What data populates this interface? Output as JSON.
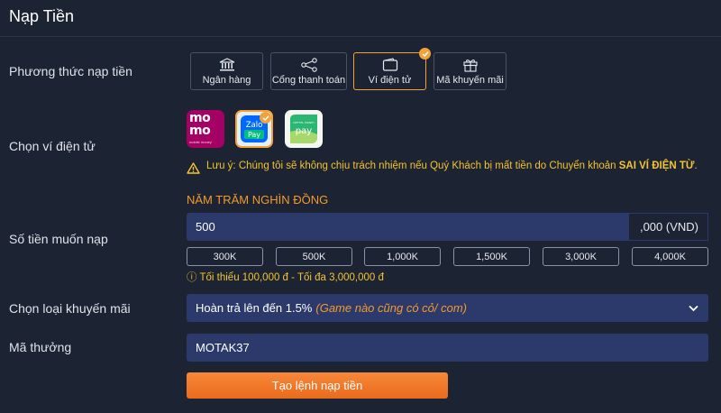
{
  "page": {
    "title": "Nạp Tiền"
  },
  "labels": {
    "method": "Phương thức nạp tiền",
    "wallet": "Chọn ví điện tử",
    "amount": "Số tiền muốn nạp",
    "promo": "Chọn loại khuyến mãi",
    "code": "Mã thưởng"
  },
  "methods": [
    {
      "label": "Ngân hàng",
      "icon": "bank-icon",
      "selected": false
    },
    {
      "label": "Cổng thanh toán",
      "icon": "share-nodes-icon",
      "selected": false
    },
    {
      "label": "Ví điện tử",
      "icon": "wallet-icon",
      "selected": true
    },
    {
      "label": "Mã khuyến mãi",
      "icon": "gift-icon",
      "selected": false
    }
  ],
  "wallets": {
    "momo": {
      "line1": "mo",
      "line2": "mo",
      "sub": "mobile money"
    },
    "zalo": {
      "line1": "Zalo",
      "line2": "Pay",
      "selected": true
    },
    "vnpay": {
      "top": "VIETTEL MONEY",
      "line": "pay"
    }
  },
  "warning": {
    "prefix": "Lưu ý: Chúng tôi sẽ không chịu trách nhiệm nếu Quý Khách bị mất tiền do Chuyển khoản ",
    "emphasis": "SAI VÍ ĐIỆN TỪ",
    "suffix": "."
  },
  "amount": {
    "words": "NĂM TRĂM NGHÌN ĐỒNG",
    "value": "500",
    "suffix": ",000 (VND)",
    "quick": [
      "300K",
      "500K",
      "1,000K",
      "1,500K",
      "3,000K",
      "4,000K"
    ],
    "limit": "ⓘ Tối thiểu 100,000 đ - Tối đa 3,000,000 đ"
  },
  "promo": {
    "value": "Hoàn trả lên đến 1.5%",
    "note": "(Game nào cũng có cỏ/ com)"
  },
  "code": {
    "value": "MOTAK37"
  },
  "submit": {
    "label": "Tạo lệnh nạp tiền"
  },
  "colors": {
    "background": "#1c2333",
    "accent": "#f3a23a",
    "field": "#2b3a6b",
    "warning": "#f3c42c",
    "button": "#ea6b1d"
  }
}
